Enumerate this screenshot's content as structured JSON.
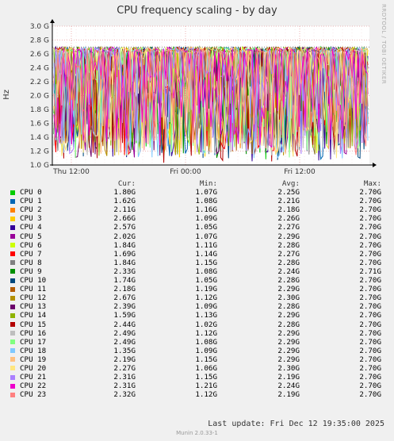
{
  "header": {
    "title": "CPU frequency scaling - by day",
    "side_credit": "RRDTOOL / TOBI OETIKER"
  },
  "chart_data": {
    "type": "line",
    "title": "CPU frequency scaling - by day",
    "ylabel": "Hz",
    "ylim": [
      1.0,
      3.0
    ],
    "yticks": [
      "1.0 G",
      "1.2 G",
      "1.4 G",
      "1.6 G",
      "1.8 G",
      "2.0 G",
      "2.2 G",
      "2.4 G",
      "2.6 G",
      "2.8 G",
      "3.0 G"
    ],
    "xticks": [
      "Thu 12:00",
      "Fri 00:00",
      "Fri 12:00"
    ],
    "grid": true,
    "max_line": 2.7,
    "series": [
      {
        "name": "CPU 0",
        "color": "#00cc00",
        "cur": "1.80G",
        "min": "1.07G",
        "avg": "2.25G",
        "max": "2.70G"
      },
      {
        "name": "CPU 1",
        "color": "#0066b3",
        "cur": "1.62G",
        "min": "1.08G",
        "avg": "2.21G",
        "max": "2.70G"
      },
      {
        "name": "CPU 2",
        "color": "#ff8000",
        "cur": "2.11G",
        "min": "1.16G",
        "avg": "2.18G",
        "max": "2.70G"
      },
      {
        "name": "CPU 3",
        "color": "#ffcc00",
        "cur": "2.66G",
        "min": "1.09G",
        "avg": "2.26G",
        "max": "2.70G"
      },
      {
        "name": "CPU 4",
        "color": "#330099",
        "cur": "2.57G",
        "min": "1.05G",
        "avg": "2.27G",
        "max": "2.70G"
      },
      {
        "name": "CPU 5",
        "color": "#990099",
        "cur": "2.02G",
        "min": "1.07G",
        "avg": "2.29G",
        "max": "2.70G"
      },
      {
        "name": "CPU 6",
        "color": "#ccff00",
        "cur": "1.84G",
        "min": "1.11G",
        "avg": "2.28G",
        "max": "2.70G"
      },
      {
        "name": "CPU 7",
        "color": "#ff0000",
        "cur": "1.69G",
        "min": "1.14G",
        "avg": "2.27G",
        "max": "2.70G"
      },
      {
        "name": "CPU 8",
        "color": "#808080",
        "cur": "1.84G",
        "min": "1.15G",
        "avg": "2.28G",
        "max": "2.70G"
      },
      {
        "name": "CPU 9",
        "color": "#008f00",
        "cur": "2.33G",
        "min": "1.08G",
        "avg": "2.24G",
        "max": "2.71G"
      },
      {
        "name": "CPU 10",
        "color": "#00487d",
        "cur": "1.74G",
        "min": "1.05G",
        "avg": "2.28G",
        "max": "2.70G"
      },
      {
        "name": "CPU 11",
        "color": "#b35a00",
        "cur": "2.18G",
        "min": "1.19G",
        "avg": "2.29G",
        "max": "2.70G"
      },
      {
        "name": "CPU 12",
        "color": "#b38f00",
        "cur": "2.67G",
        "min": "1.12G",
        "avg": "2.30G",
        "max": "2.70G"
      },
      {
        "name": "CPU 13",
        "color": "#6b006b",
        "cur": "2.39G",
        "min": "1.09G",
        "avg": "2.28G",
        "max": "2.70G"
      },
      {
        "name": "CPU 14",
        "color": "#8fb300",
        "cur": "1.59G",
        "min": "1.13G",
        "avg": "2.29G",
        "max": "2.70G"
      },
      {
        "name": "CPU 15",
        "color": "#b30000",
        "cur": "2.44G",
        "min": "1.02G",
        "avg": "2.28G",
        "max": "2.70G"
      },
      {
        "name": "CPU 16",
        "color": "#bebebe",
        "cur": "2.49G",
        "min": "1.12G",
        "avg": "2.29G",
        "max": "2.70G"
      },
      {
        "name": "CPU 17",
        "color": "#80ff80",
        "cur": "2.49G",
        "min": "1.08G",
        "avg": "2.29G",
        "max": "2.70G"
      },
      {
        "name": "CPU 18",
        "color": "#80c9ff",
        "cur": "1.35G",
        "min": "1.09G",
        "avg": "2.29G",
        "max": "2.70G"
      },
      {
        "name": "CPU 19",
        "color": "#ffc080",
        "cur": "2.19G",
        "min": "1.15G",
        "avg": "2.29G",
        "max": "2.70G"
      },
      {
        "name": "CPU 20",
        "color": "#ffe680",
        "cur": "2.27G",
        "min": "1.06G",
        "avg": "2.30G",
        "max": "2.70G"
      },
      {
        "name": "CPU 21",
        "color": "#aa80ff",
        "cur": "2.31G",
        "min": "1.15G",
        "avg": "2.19G",
        "max": "2.70G"
      },
      {
        "name": "CPU 22",
        "color": "#ee00cc",
        "cur": "2.31G",
        "min": "1.21G",
        "avg": "2.24G",
        "max": "2.70G"
      },
      {
        "name": "CPU 23",
        "color": "#ff8080",
        "cur": "2.32G",
        "min": "1.12G",
        "avg": "2.19G",
        "max": "2.70G"
      }
    ]
  },
  "legend_headers": {
    "cur": "Cur:",
    "min": "Min:",
    "avg": "Avg:",
    "max": "Max:"
  },
  "last_update": "Last update:  Fri Dec 12 19:35:00 2025",
  "footer": "Munin 2.0.33-1"
}
